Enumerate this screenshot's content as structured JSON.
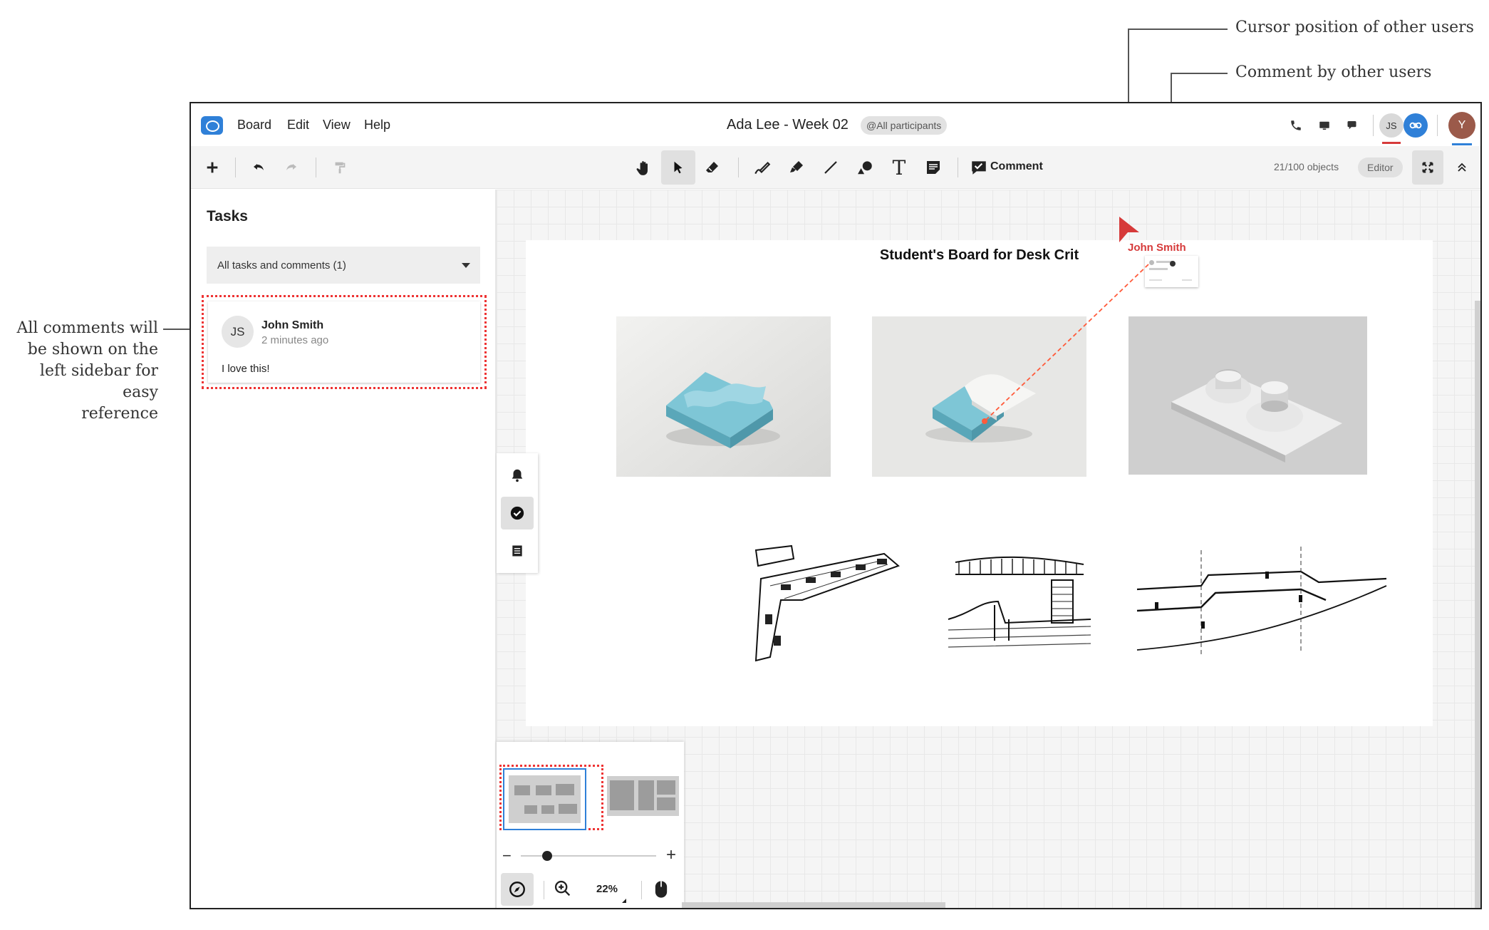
{
  "annotations": {
    "cursor_label": "Cursor position of other users",
    "comment_label": "Comment by other users",
    "sidebar_label_lines": [
      "All comments will",
      "be shown on the",
      "left sidebar for easy",
      "reference"
    ]
  },
  "menubar": {
    "items": [
      "Board",
      "Edit",
      "View",
      "Help"
    ],
    "title": "Ada Lee - Week 02",
    "participants_pill": "@All participants",
    "user_badges": {
      "js": "JS",
      "y": "Y"
    }
  },
  "toolbar": {
    "comment_label": "Comment",
    "objects_count": "21/100 objects",
    "role_label": "Editor"
  },
  "sidebar": {
    "title": "Tasks",
    "filter_value": "All tasks and comments (1)",
    "comment": {
      "initials": "JS",
      "author": "John Smith",
      "time": "2 minutes ago",
      "body": "I love this!"
    }
  },
  "canvas": {
    "board_title": "Student's Board for Desk Crit",
    "remote_cursor_name": "John Smith"
  },
  "minimap": {
    "zoom_level": "22%",
    "minus": "−",
    "plus": "+"
  },
  "colors": {
    "accent": "#2f80d8",
    "remote_user": "#d63a3a",
    "highlight_dotted": "#e33333"
  }
}
